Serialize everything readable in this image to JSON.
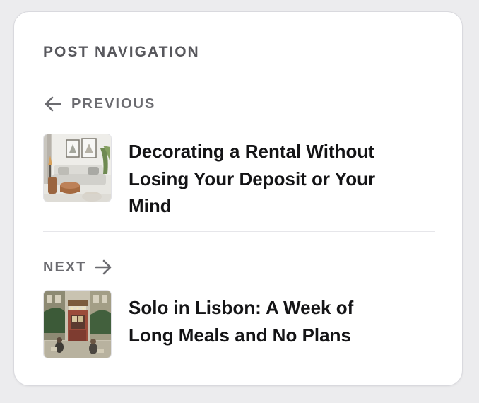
{
  "nav": {
    "heading": "POST NAVIGATION",
    "previous": {
      "label": "PREVIOUS",
      "title": "Decorating a Rental Without Losing Your Deposit or Your Mind",
      "arrow_icon": "arrow-left-icon"
    },
    "next": {
      "label": "NEXT",
      "title": "Solo in Lisbon: A Week of Long Meals and No Plans",
      "arrow_icon": "arrow-right-icon"
    }
  },
  "colors": {
    "heading": "#57575c",
    "label": "#6b6b70",
    "title": "#141416",
    "divider": "#e6e6ea",
    "card_background": "#ffffff",
    "page_background": "#ececee"
  }
}
